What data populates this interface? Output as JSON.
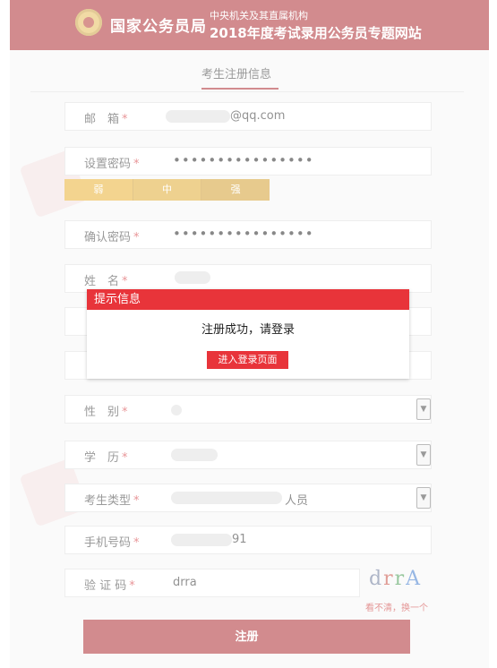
{
  "header": {
    "bureau": "国家公务员局",
    "subtitle_top": "中央机关及其直属机构",
    "subtitle_main": "2018年度考试录用公务员专题网站"
  },
  "tab": {
    "label": "考生注册信息"
  },
  "form": {
    "email": {
      "label": "邮　箱",
      "value": "@qq.com"
    },
    "password": {
      "label": "设置密码",
      "value": "••••••••••••••••"
    },
    "strength": [
      "弱",
      "中",
      "强"
    ],
    "confirm": {
      "label": "确认密码",
      "value": "••••••••••••••••"
    },
    "name": {
      "label": "姓　名"
    },
    "gender": {
      "label": "性　别"
    },
    "education": {
      "label": "学　历"
    },
    "category": {
      "label": "考生类型",
      "value": "人员"
    },
    "phone": {
      "label": "手机号码",
      "value": "91"
    },
    "captcha": {
      "label": "验 证 码",
      "value": "drra",
      "image": [
        "d",
        "r",
        "r",
        "A"
      ],
      "refresh": "看不清，换一个"
    },
    "required_mark": "*",
    "submit": "注册"
  },
  "modal": {
    "title": "提示信息",
    "message": "注册成功，请登录",
    "button": "进入登录页面"
  },
  "colors": {
    "brand": "#a5161c",
    "accent": "#e8343a"
  },
  "icons": {
    "emblem": "national-emblem-icon",
    "dropdown": "chevron-down-icon"
  }
}
